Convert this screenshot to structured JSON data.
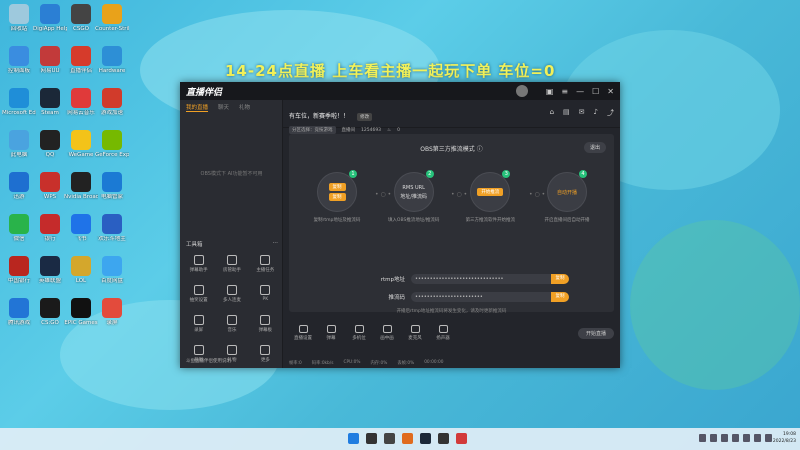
{
  "banner": "14-24点直播    上车看主播一起玩下单  车位=0",
  "desktop_icons": [
    {
      "label": "回收站",
      "color": "#9ec9dd"
    },
    {
      "label": "DigiApp Helper",
      "color": "#2b7fd4"
    },
    {
      "label": "CSGO",
      "color": "#444"
    },
    {
      "label": "Counter-Strike GO",
      "color": "#e9a21a"
    },
    {
      "label": "控制面板",
      "color": "#3a8de0"
    },
    {
      "label": "网易UU",
      "color": "#c23a3a"
    },
    {
      "label": "直播伴侣",
      "color": "#d63b2b"
    },
    {
      "label": "Hardware",
      "color": "#2d8fd6"
    },
    {
      "label": "Microsoft Edge",
      "color": "#1f8ed8"
    },
    {
      "label": "Steam",
      "color": "#1b2838"
    },
    {
      "label": "网易云音乐",
      "color": "#e03a3a"
    },
    {
      "label": "游戏加速",
      "color": "#d13b2b"
    },
    {
      "label": "此电脑",
      "color": "#4aa3df"
    },
    {
      "label": "QQ",
      "color": "#222"
    },
    {
      "label": "WeGame",
      "color": "#f3c319"
    },
    {
      "label": "GeForce Experience",
      "color": "#76b900"
    },
    {
      "label": "迅游",
      "color": "#1e6fd0"
    },
    {
      "label": "WPS",
      "color": "#c8302b"
    },
    {
      "label": "Nvidia Broadcast",
      "color": "#222"
    },
    {
      "label": "电脑管家",
      "color": "#1b7ad4"
    },
    {
      "label": "微信",
      "color": "#29b34a"
    },
    {
      "label": "银行",
      "color": "#c52b2b"
    },
    {
      "label": "飞书",
      "color": "#1f73e8"
    },
    {
      "label": "欢乐斗地主",
      "color": "#2a5fc2"
    },
    {
      "label": "中国银行",
      "color": "#b9261f"
    },
    {
      "label": "英雄联盟",
      "color": "#1a2a44"
    },
    {
      "label": "LOL",
      "color": "#d4a72c"
    },
    {
      "label": "百度网盘",
      "color": "#3da6ef"
    },
    {
      "label": "腾讯游戏",
      "color": "#2275d6"
    },
    {
      "label": "CS:GO",
      "color": "#1a1a1a"
    },
    {
      "label": "EPIC Games",
      "color": "#111"
    },
    {
      "label": "录屏",
      "color": "#e34b3c"
    }
  ],
  "window": {
    "logo": "直播伴侣",
    "titlebar_buttons": [
      "skin-icon",
      "menu-icon",
      "minimize-icon",
      "close-icon"
    ],
    "left_tabs": [
      "我的直播",
      "聊天",
      "礼物"
    ],
    "left_empty_text": "OBS模式下 AI功能暂不可用",
    "tools_header": "工具箱",
    "tools": [
      {
        "label": "弹幕助手"
      },
      {
        "label": "房管助手"
      },
      {
        "label": "主播任务"
      },
      {
        "label": "抽奖设置"
      },
      {
        "label": "多人连麦"
      },
      {
        "label": "PK"
      },
      {
        "label": "录屏"
      },
      {
        "label": "音乐"
      },
      {
        "label": "弹幕板"
      },
      {
        "label": "截图"
      },
      {
        "label": "礼物"
      },
      {
        "label": "更多"
      }
    ],
    "left_footer": "斗鱼直播伴侣使用说明",
    "stream_title": "有车位，新赛季啦！！",
    "edit_label": "修改",
    "sub_info": [
      "分区选择：竞技游戏",
      "直播间",
      "1254693",
      "0"
    ],
    "right_icons": [
      "shop-icon",
      "bag-icon",
      "gift-icon",
      "bell-icon",
      "share-icon"
    ],
    "mode_title": "OBS第三方推流模式",
    "exit_label": "退出",
    "steps": [
      {
        "num": "1",
        "lines": [
          "复制",
          "复制"
        ],
        "desc": "复制rtmp地址及推流码"
      },
      {
        "num": "2",
        "lines": [
          "RMS URL",
          "地址/推流码"
        ],
        "desc": "填入OBS推流地址/推流码"
      },
      {
        "num": "3",
        "lines": [
          "开始推流"
        ],
        "desc": "第三方推流软件开始推流"
      },
      {
        "num": "4",
        "lines": [
          "自动开播"
        ],
        "desc": "开启直播间后自动开播"
      }
    ],
    "rtmp_label": "rtmp地址",
    "rtmp_value": "••••••••••••••••••••••••••••••",
    "key_label": "推流码",
    "key_value": "•••••••••••••••••••••••",
    "copy_label": "复制",
    "hint": "开播后rtmp地址推流码将发生变化，请及时更新推流码",
    "bottom_tools": [
      "直播设置",
      "弹幕",
      "多机位",
      "画中画",
      "麦克风",
      "扬声器"
    ],
    "start_label": "开始直播",
    "status": [
      "帧率:0",
      "码率:0kb/s",
      "CPU:0%",
      "内存:0%",
      "丢帧:0%",
      "00:00:00"
    ]
  },
  "taskbar": {
    "icons": [
      {
        "name": "windows-start-icon",
        "color": "#1f7de0"
      },
      {
        "name": "search-icon",
        "color": "#333"
      },
      {
        "name": "task-view-icon",
        "color": "#444"
      },
      {
        "name": "app-icon-1",
        "color": "#e06b1e"
      },
      {
        "name": "steam-icon",
        "color": "#1b2838"
      },
      {
        "name": "app-icon-2",
        "color": "#333"
      },
      {
        "name": "netease-icon",
        "color": "#d23a3a"
      }
    ],
    "time": "19:08",
    "date": "2022/8/23"
  }
}
